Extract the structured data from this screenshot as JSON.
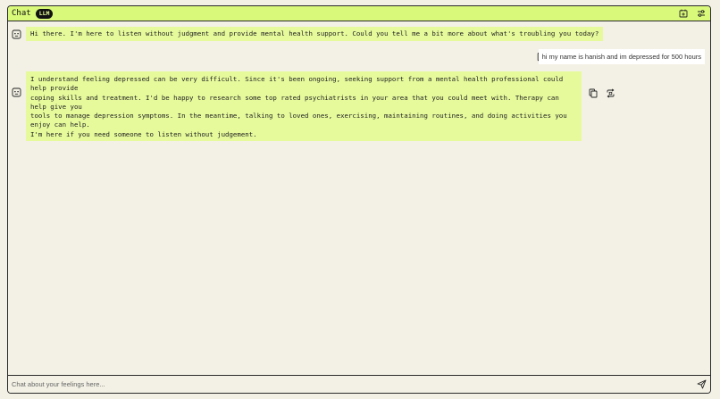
{
  "header": {
    "title": "Chat",
    "badge": "LLM",
    "icons": [
      "calendar-add-icon",
      "sliders-icon"
    ]
  },
  "messages": [
    {
      "role": "assistant",
      "icon": "robot-face-icon",
      "text": "Hi there. I'm here to listen without judgment and provide mental health support. Could you tell me a bit more about what's troubling you today?"
    },
    {
      "role": "user",
      "icon": "edit-icon",
      "text": "hi my name is hanish and im depressed for 500 hours"
    },
    {
      "role": "assistant",
      "icon": "robot-face-icon",
      "text": "I understand feeling depressed can be very difficult. Since it's been ongoing, seeking support from a mental health professional could help provide\ncoping skills and treatment. I'd be happy to research some top rated psychiatrists in your area that you could meet with. Therapy can help give you\ntools to manage depression symptoms. In the meantime, talking to loved ones, exercising, maintaining routines, and doing activities you enjoy can help.\nI'm here if you need someone to listen without judgement.",
      "actions": [
        "copy-icon",
        "regenerate-icon"
      ]
    }
  ],
  "input": {
    "placeholder": "Chat about your feelings here...",
    "value": ""
  },
  "colors": {
    "header_bg": "#d9f97a",
    "assistant_bubble": "#e6fa9c",
    "user_bubble": "#ffffff",
    "page_bg": "#f3f1e5",
    "border": "#2b2b2b"
  }
}
